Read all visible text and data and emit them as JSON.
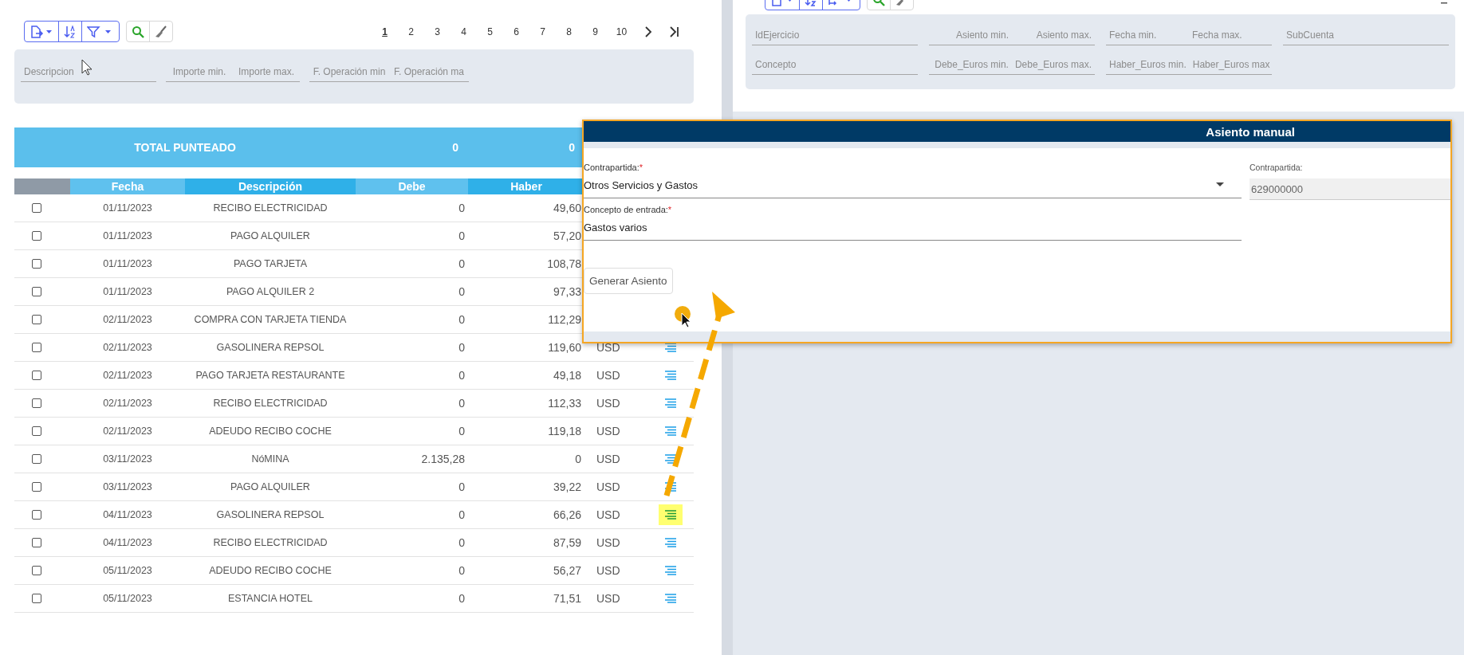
{
  "left_panel": {
    "pagination": {
      "pages": [
        {
          "label": "1",
          "selected": true
        },
        {
          "label": "2",
          "selected": false
        },
        {
          "label": "3",
          "selected": false
        },
        {
          "label": "4",
          "selected": false
        },
        {
          "label": "5",
          "selected": false
        },
        {
          "label": "6",
          "selected": false
        },
        {
          "label": "7",
          "selected": false
        },
        {
          "label": "8",
          "selected": false
        },
        {
          "label": "9",
          "selected": false
        },
        {
          "label": "10",
          "selected": false
        }
      ]
    },
    "filters": [
      {
        "placeholders": [
          "Descripcion"
        ]
      },
      {
        "placeholders": [
          "Importe min.",
          "Importe max."
        ]
      },
      {
        "placeholders": [
          "F. Operación min",
          "F. Operación ma"
        ]
      }
    ],
    "total": {
      "label": "TOTAL PUNTEADO",
      "debe": "0",
      "haber": "0"
    },
    "table": {
      "columns": [
        "Fecha",
        "Descripción",
        "Debe",
        "Haber"
      ],
      "rows": [
        {
          "checked": false,
          "fecha": "01/11/2023",
          "descripcion": "RECIBO ELECTRICIDAD",
          "debe": "0",
          "haber": "49,60"
        },
        {
          "checked": false,
          "fecha": "01/11/2023",
          "descripcion": "PAGO ALQUILER",
          "debe": "0",
          "haber": "57,20"
        },
        {
          "checked": false,
          "fecha": "01/11/2023",
          "descripcion": "PAGO TARJETA",
          "debe": "0",
          "haber": "108,78"
        },
        {
          "checked": false,
          "fecha": "01/11/2023",
          "descripcion": "PAGO ALQUILER 2",
          "debe": "0",
          "haber": "97,33"
        },
        {
          "checked": false,
          "fecha": "02/11/2023",
          "descripcion": "COMPRA CON TARJETA TIENDA",
          "debe": "0",
          "haber": "112,29"
        },
        {
          "checked": false,
          "fecha": "02/11/2023",
          "descripcion": "GASOLINERA REPSOL",
          "debe": "0",
          "haber": "119,60",
          "currency": "USD",
          "highlighted": false
        },
        {
          "checked": false,
          "fecha": "02/11/2023",
          "descripcion": "PAGO TARJETA RESTAURANTE",
          "debe": "0",
          "haber": "49,18",
          "currency": "USD",
          "highlighted": false
        },
        {
          "checked": false,
          "fecha": "02/11/2023",
          "descripcion": "RECIBO ELECTRICIDAD",
          "debe": "0",
          "haber": "112,33",
          "currency": "USD",
          "highlighted": false
        },
        {
          "checked": false,
          "fecha": "02/11/2023",
          "descripcion": "ADEUDO RECIBO COCHE",
          "debe": "0",
          "haber": "119,18",
          "currency": "USD",
          "highlighted": false
        },
        {
          "checked": false,
          "fecha": "03/11/2023",
          "descripcion": "NóMINA",
          "debe": "2.135,28",
          "haber": "0",
          "currency": "USD",
          "highlighted": false
        },
        {
          "checked": false,
          "fecha": "03/11/2023",
          "descripcion": "PAGO ALQUILER",
          "debe": "0",
          "haber": "39,22",
          "currency": "USD",
          "highlighted": false
        },
        {
          "checked": false,
          "fecha": "04/11/2023",
          "descripcion": "GASOLINERA REPSOL",
          "debe": "0",
          "haber": "66,26",
          "currency": "USD",
          "highlighted": true
        },
        {
          "checked": false,
          "fecha": "04/11/2023",
          "descripcion": "RECIBO ELECTRICIDAD",
          "debe": "0",
          "haber": "87,59",
          "currency": "USD",
          "highlighted": false
        },
        {
          "checked": false,
          "fecha": "05/11/2023",
          "descripcion": "ADEUDO RECIBO COCHE",
          "debe": "0",
          "haber": "56,27",
          "currency": "USD",
          "highlighted": false
        },
        {
          "checked": false,
          "fecha": "05/11/2023",
          "descripcion": "ESTANCIA HOTEL",
          "debe": "0",
          "haber": "71,51",
          "currency": "USD",
          "highlighted": false
        }
      ]
    }
  },
  "right_panel": {
    "filter_rows": [
      [
        {
          "placeholders": [
            "IdEjercicio"
          ]
        },
        {
          "placeholders": [
            "Asiento min.",
            "Asiento max."
          ]
        },
        {
          "placeholders": [
            "Fecha min.",
            "Fecha max."
          ]
        },
        {
          "placeholders": [
            "SubCuenta"
          ]
        }
      ],
      [
        {
          "placeholders": [
            "Concepto"
          ]
        },
        {
          "placeholders": [
            "Debe_Euros min.",
            "Debe_Euros max."
          ]
        },
        {
          "placeholders": [
            "Haber_Euros min.",
            "Haber_Euros max"
          ]
        }
      ]
    ]
  },
  "dialog": {
    "title": "Asiento manual",
    "fields": [
      {
        "kind": "select",
        "label": "Contrapartida:",
        "required_mark": "*",
        "value": "Otros Servicios y Gastos"
      },
      {
        "kind": "text",
        "label": "Concepto de entrada:",
        "required_mark": "*",
        "value": "Gastos varios"
      }
    ],
    "side_field": {
      "label": "Contrapartida:",
      "value": "629000000"
    },
    "button": "Generar Asiento"
  }
}
